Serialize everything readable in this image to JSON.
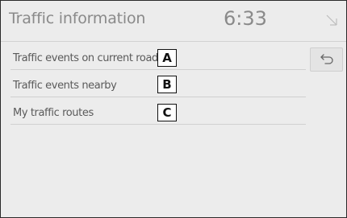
{
  "header": {
    "title": "Traffic information",
    "clock": "6:33"
  },
  "menu": {
    "items": [
      {
        "label": "Traffic events on current road",
        "callout": "A"
      },
      {
        "label": "Traffic events nearby",
        "callout": "B"
      },
      {
        "label": "My traffic routes",
        "callout": "C"
      }
    ]
  },
  "icons": {
    "back": "back-arrow-icon",
    "status": "signal-icon"
  },
  "colors": {
    "screen_bg": "#ececec",
    "text": "#5a5a5a",
    "title": "#8a8a8a"
  }
}
